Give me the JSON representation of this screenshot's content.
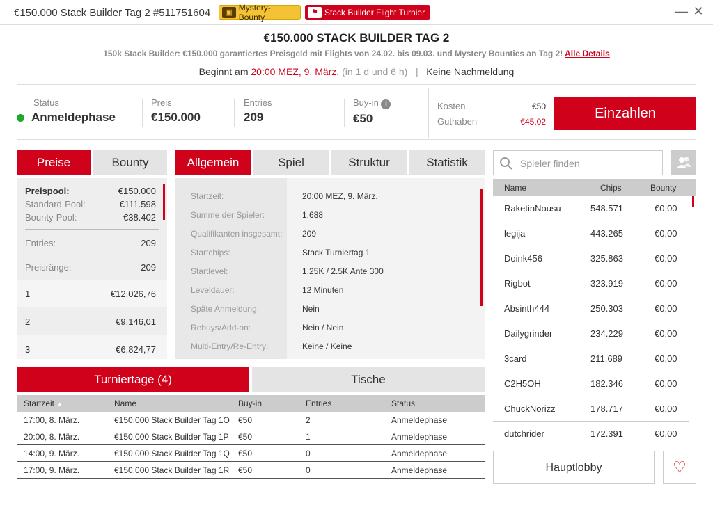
{
  "window": {
    "title": "€150.000 Stack Builder Tag 2 #511751604",
    "badge_mystery": "Mystery-Bounty",
    "badge_flight": "Stack Builder Flight Turnier",
    "minimize": "—",
    "close": "✕"
  },
  "header": {
    "title": "€150.000 STACK BUILDER TAG 2",
    "subtitle": "150k Stack Builder: €150.000 garantiertes Preisgeld mit Flights von 24.02. bis 09.03. und Mystery Bounties an Tag 2!",
    "details_link": "Alle Details",
    "start_prefix": "Beginnt am",
    "start_time": "20:00 MEZ, 9. März.",
    "start_relative": "(in 1 d und 6 h)",
    "separator": "|",
    "late_reg": "Keine Nachmeldung"
  },
  "info": {
    "status_label": "Status",
    "status_value": "Anmeldephase",
    "price_label": "Preis",
    "price_value": "€150.000",
    "entries_label": "Entries",
    "entries_value": "209",
    "buyin_label": "Buy-in",
    "buyin_value": "€50",
    "cost_label": "Kosten",
    "cost_value": "€50",
    "balance_label": "Guthaben",
    "balance_value": "€45,02",
    "deposit_button": "Einzahlen",
    "status_color": "#1fa82a",
    "accent": "#d0021b"
  },
  "prize_tabs": [
    "Preise",
    "Bounty"
  ],
  "prizes": {
    "pool_label": "Preispool:",
    "pool_value": "€150.000",
    "standard_label": "Standard-Pool:",
    "standard_value": "€111.598",
    "bounty_label": "Bounty-Pool:",
    "bounty_value": "€38.402",
    "entries_label": "Entries:",
    "entries_value": "209",
    "ranks_label": "Preisränge:",
    "ranks_value": "209",
    "places": [
      {
        "rank": "1",
        "amount": "€12.026,76"
      },
      {
        "rank": "2",
        "amount": "€9.146,01"
      },
      {
        "rank": "3",
        "amount": "€6.824,77"
      }
    ]
  },
  "info_tabs": [
    "Allgemein",
    "Spiel",
    "Struktur",
    "Statistik"
  ],
  "general": [
    {
      "label": "Startzeit:",
      "value": "20:00 MEZ, 9. März."
    },
    {
      "label": "Summe der Spieler:",
      "value": "1.688"
    },
    {
      "label": "Qualifikanten insgesamt:",
      "value": "209"
    },
    {
      "label": "Startchips:",
      "value": "Stack Turniertag 1"
    },
    {
      "label": "Startlevel:",
      "value": "1.25K / 2.5K Ante 300"
    },
    {
      "label": "Leveldauer:",
      "value": "12 Minuten"
    },
    {
      "label": "Späte Anmeldung:",
      "value": "Nein"
    },
    {
      "label": "Rebuys/Add-on:",
      "value": "Nein / Nein"
    },
    {
      "label": "Multi-Entry/Re-Entry:",
      "value": "Keine / Keine"
    }
  ],
  "bottom_tabs": [
    "Turniertage (4)",
    "Tische"
  ],
  "days_table": {
    "headers": [
      "Startzeit",
      "Name",
      "Buy-in",
      "Entries",
      "Status"
    ],
    "sort_icon": "▲",
    "rows": [
      [
        "17:00, 8. März.",
        "€150.000 Stack Builder Tag 1O",
        "€50",
        "2",
        "Anmeldephase"
      ],
      [
        "20:00, 8. März.",
        "€150.000 Stack Builder Tag 1P",
        "€50",
        "1",
        "Anmeldephase"
      ],
      [
        "14:00, 9. März.",
        "€150.000 Stack Builder Tag 1Q",
        "€50",
        "0",
        "Anmeldephase"
      ],
      [
        "17:00, 9. März.",
        "€150.000 Stack Builder Tag 1R",
        "€50",
        "0",
        "Anmeldephase"
      ]
    ]
  },
  "players": {
    "search_placeholder": "Spieler finden",
    "headers": [
      "Name",
      "Chips",
      "Bounty"
    ],
    "rows": [
      [
        "RaketinNousu",
        "548.571",
        "€0,00"
      ],
      [
        "legija",
        "443.265",
        "€0,00"
      ],
      [
        "Doink456",
        "325.863",
        "€0,00"
      ],
      [
        "Rigbot",
        "323.919",
        "€0,00"
      ],
      [
        "Absinth444",
        "250.303",
        "€0,00"
      ],
      [
        "Dailygrinder",
        "234.229",
        "€0,00"
      ],
      [
        "3card",
        "211.689",
        "€0,00"
      ],
      [
        "C2H5OH",
        "182.346",
        "€0,00"
      ],
      [
        "ChuckNorizz",
        "178.717",
        "€0,00"
      ],
      [
        "dutchrider",
        "172.391",
        "€0,00"
      ]
    ]
  },
  "footer": {
    "lobby_button": "Hauptlobby",
    "favorite_icon": "♡"
  }
}
